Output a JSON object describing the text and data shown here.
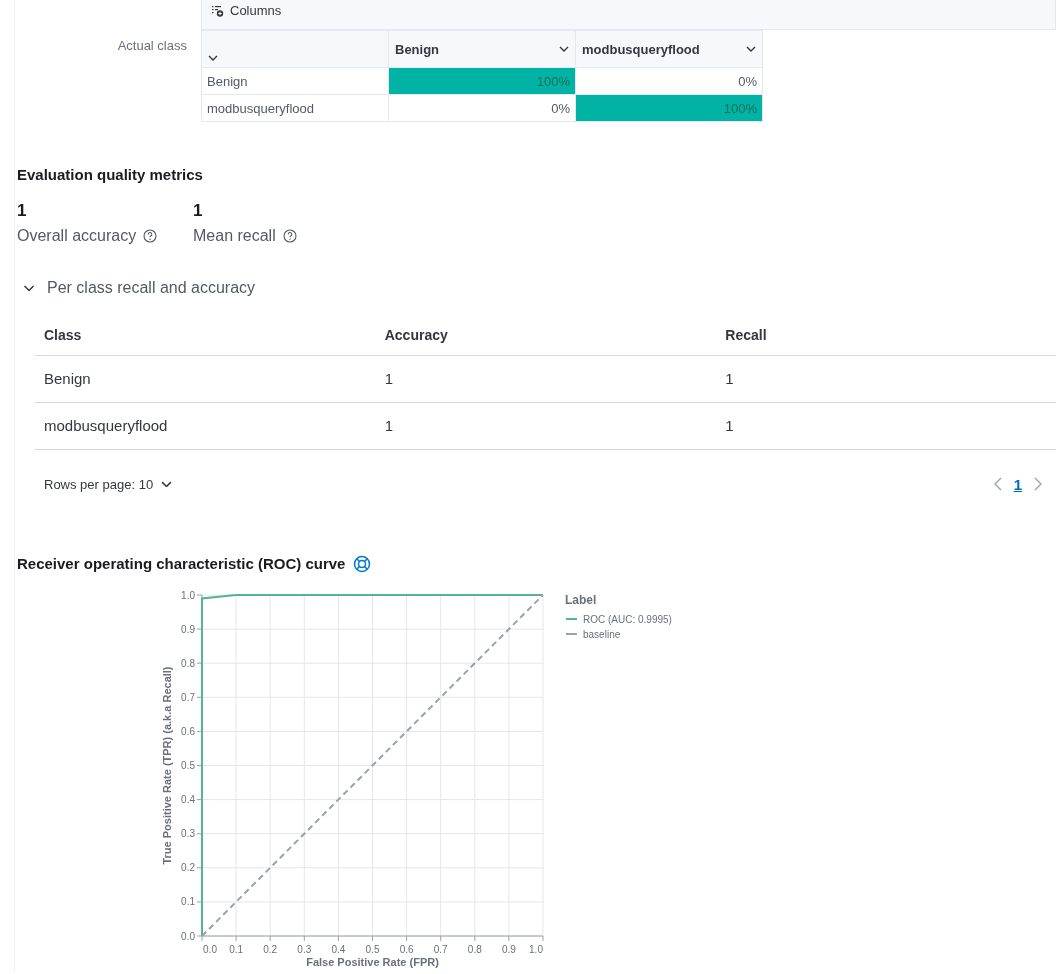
{
  "columns_button": {
    "label": "Columns"
  },
  "confusion_matrix": {
    "row_axis_label": "Actual class",
    "columns": [
      "",
      "Benign",
      "modbusqueryflood"
    ],
    "rows": [
      {
        "cells": [
          {
            "text": "Benign",
            "highlighted": false
          },
          {
            "text": "100%",
            "highlighted": true
          },
          {
            "text": "0%",
            "highlighted": false
          }
        ]
      },
      {
        "cells": [
          {
            "text": "modbusqueryflood",
            "highlighted": false
          },
          {
            "text": "0%",
            "highlighted": false
          },
          {
            "text": "100%",
            "highlighted": true
          }
        ]
      }
    ]
  },
  "metrics": {
    "title": "Evaluation quality metrics",
    "items": [
      {
        "value": "1",
        "label": "Overall accuracy"
      },
      {
        "value": "1",
        "label": "Mean recall"
      }
    ]
  },
  "per_class": {
    "title": "Per class recall and accuracy",
    "expanded": true,
    "columns": [
      "Class",
      "Accuracy",
      "Recall"
    ],
    "rows": [
      [
        "Benign",
        "1",
        "1"
      ],
      [
        "modbusqueryflood",
        "1",
        "1"
      ]
    ],
    "rows_per_page": "Rows per page: 10",
    "pages": [
      {
        "label": "1",
        "selected": true
      }
    ]
  },
  "roc": {
    "title": "Receiver operating characteristic (ROC) curve",
    "chart_data": {
      "type": "line",
      "xlabel": "False Positive Rate (FPR)",
      "ylabel": "True Positive Rate (TPR) (a.k.a Recall)",
      "grid": true,
      "legend": {
        "title": "Label"
      },
      "x": [
        0,
        0,
        0.1,
        1
      ],
      "series": [
        {
          "name": "ROC (AUC: 0.9995)",
          "color": "#54b399",
          "line_style": "solid",
          "values": [
            0,
            0.99,
            1,
            1
          ]
        },
        {
          "name": "baseline",
          "color": "#98a2b3",
          "line_style": "dashed",
          "values": [
            0,
            null,
            0.1,
            1
          ]
        }
      ],
      "xlim": [
        0,
        1
      ],
      "ylim": [
        0,
        1
      ],
      "xticks": [
        {
          "value": 0,
          "label": "0.0"
        },
        {
          "value": 0.1,
          "label": "0.1"
        },
        {
          "value": 0.2,
          "label": "0.2"
        },
        {
          "value": 0.3,
          "label": "0.3"
        },
        {
          "value": 0.4,
          "label": "0.4"
        },
        {
          "value": 0.5,
          "label": "0.5"
        },
        {
          "value": 0.6,
          "label": "0.6"
        },
        {
          "value": 0.7,
          "label": "0.7"
        },
        {
          "value": 0.8,
          "label": "0.8"
        },
        {
          "value": 0.9,
          "label": "0.9"
        },
        {
          "value": 1,
          "label": "1.0"
        }
      ],
      "yticks": [
        {
          "value": 0,
          "label": "0.0"
        },
        {
          "value": 0.1,
          "label": "0.1"
        },
        {
          "value": 0.2,
          "label": "0.2"
        },
        {
          "value": 0.3,
          "label": "0.3"
        },
        {
          "value": 0.4,
          "label": "0.4"
        },
        {
          "value": 0.5,
          "label": "0.5"
        },
        {
          "value": 0.6,
          "label": "0.6"
        },
        {
          "value": 0.7,
          "label": "0.7"
        },
        {
          "value": 0.8,
          "label": "0.8"
        },
        {
          "value": 0.9,
          "label": "0.9"
        },
        {
          "value": 1,
          "label": "1.0"
        }
      ]
    }
  }
}
